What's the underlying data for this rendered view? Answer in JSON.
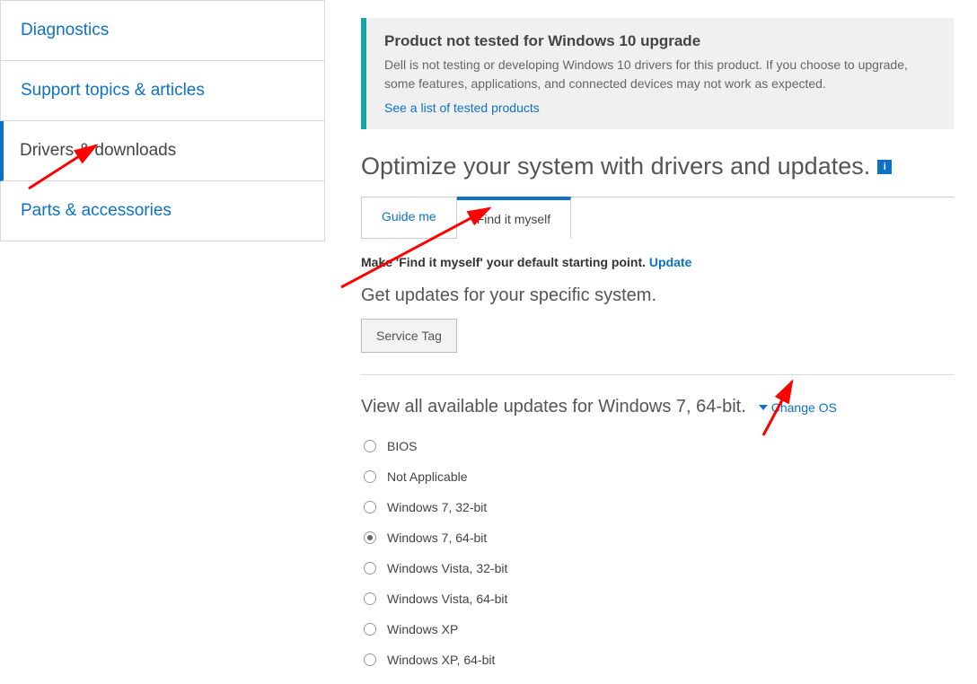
{
  "sidebar": {
    "items": [
      {
        "label": "Diagnostics"
      },
      {
        "label": "Support topics & articles"
      },
      {
        "label": "Drivers & downloads",
        "active": true
      },
      {
        "label": "Parts & accessories"
      }
    ]
  },
  "notice": {
    "title": "Product not tested for Windows 10 upgrade",
    "body": "Dell is not testing or developing Windows 10 drivers for this product. If you choose to upgrade, some features, applications, and connected devices may not work as expected.",
    "link": "See a list of tested products"
  },
  "headline": "Optimize your system with drivers and updates.",
  "tabs": [
    {
      "label": "Guide me"
    },
    {
      "label": "Find it myself",
      "active": true
    }
  ],
  "default_line": {
    "prefix": "Make 'Find it myself' your default starting point. ",
    "link": "Update"
  },
  "subhead": "Get updates for your specific system.",
  "service_tag_btn": "Service Tag",
  "view_line": {
    "text": "View all available updates for Windows 7, 64-bit.",
    "change_os": "Change OS"
  },
  "os_list": [
    {
      "label": "BIOS",
      "selected": false
    },
    {
      "label": "Not Applicable",
      "selected": false
    },
    {
      "label": "Windows 7, 32-bit",
      "selected": false
    },
    {
      "label": "Windows 7, 64-bit",
      "selected": true
    },
    {
      "label": "Windows Vista, 32-bit",
      "selected": false
    },
    {
      "label": "Windows Vista, 64-bit",
      "selected": false
    },
    {
      "label": "Windows XP",
      "selected": false
    },
    {
      "label": "Windows XP, 64-bit",
      "selected": false
    }
  ]
}
